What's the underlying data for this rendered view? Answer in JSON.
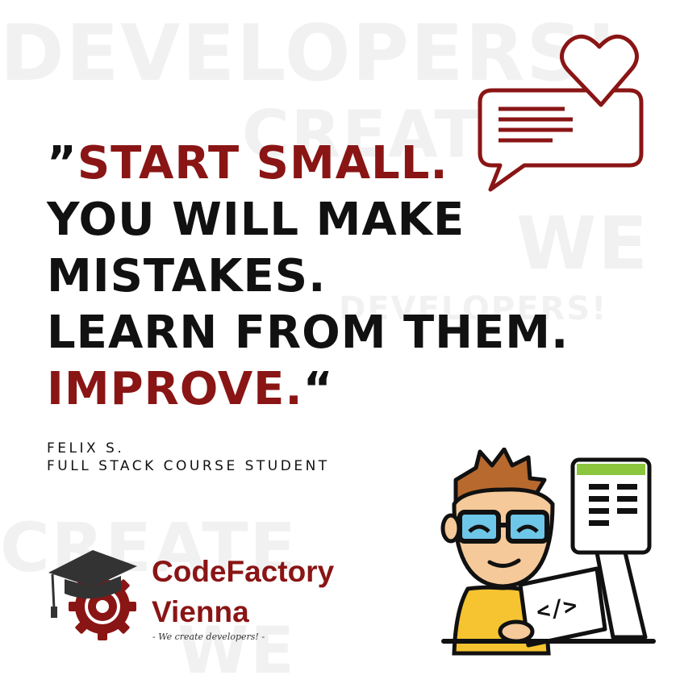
{
  "colors": {
    "accent": "#8a1515",
    "text": "#111111"
  },
  "background_words": [
    "DEVELOPERS!",
    "CREATE",
    "WE",
    "DEVELOPERS!",
    "CREATE",
    "WE"
  ],
  "quote": {
    "open_mark": "”",
    "line1_accent": "START SMALL.",
    "line2": "YOU WILL MAKE",
    "line3": "MISTAKES.",
    "line4": "LEARN FROM THEM.",
    "line5_accent": "IMPROVE.",
    "close_mark": "“"
  },
  "author": {
    "name": "FELIX S.",
    "title": "FULL STACK COURSE STUDENT"
  },
  "brand": {
    "line1": "CodeFactory",
    "line2": "Vienna",
    "tagline": "- We create developers! -"
  },
  "illustration": {
    "code_symbol": "</>"
  },
  "icons": [
    "chat-heart-icon",
    "graduation-gear-logo-icon",
    "developer-illustration"
  ]
}
